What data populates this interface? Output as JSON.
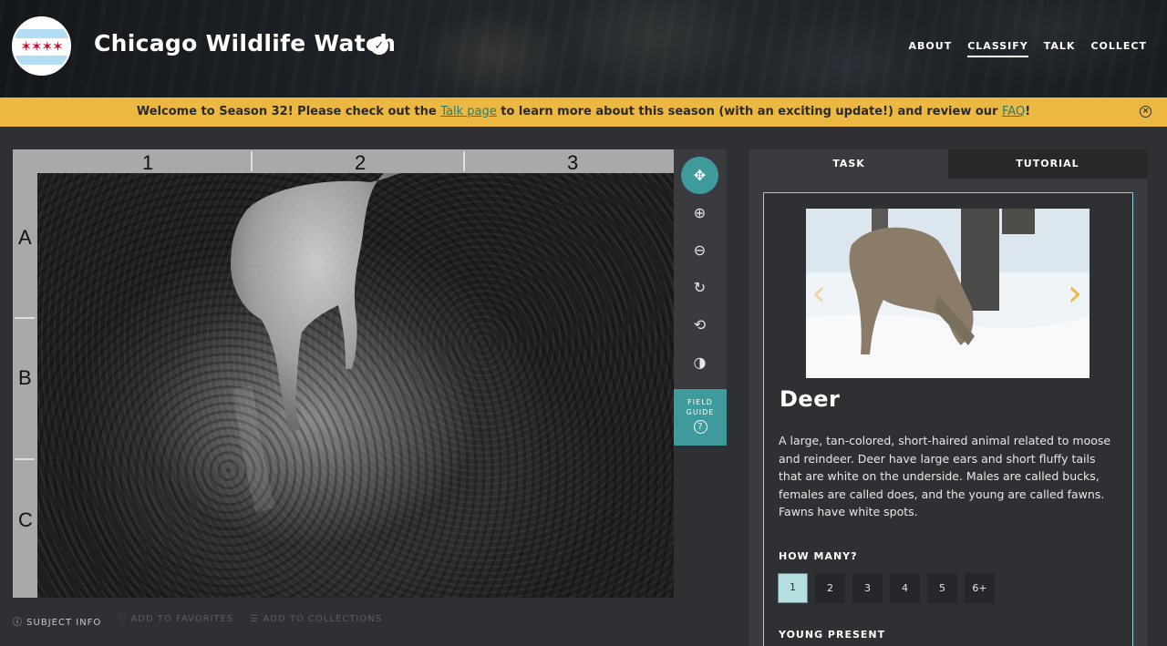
{
  "header": {
    "title": "Chicago Wildlife Watch",
    "logo_stars": "✶✶✶✶",
    "verified_icon": "✓",
    "nav": [
      {
        "label": "ABOUT",
        "active": false
      },
      {
        "label": "CLASSIFY",
        "active": true
      },
      {
        "label": "TALK",
        "active": false
      },
      {
        "label": "COLLECT",
        "active": false
      }
    ]
  },
  "banner": {
    "text_before": "Welcome to Season 32! Please check out the ",
    "link1": "Talk page",
    "text_middle": " to learn more about this season (with an exciting update!) and review our ",
    "link2": "FAQ",
    "text_after": "!",
    "close_icon": "×"
  },
  "viewer": {
    "columns": [
      "1",
      "2",
      "3"
    ],
    "rows": [
      "A",
      "B",
      "C"
    ],
    "tools": [
      {
        "name": "move-icon",
        "glyph": "✥",
        "active": true
      },
      {
        "name": "zoom-in-icon",
        "glyph": "⊕",
        "active": false
      },
      {
        "name": "zoom-out-icon",
        "glyph": "⊖",
        "active": false
      },
      {
        "name": "rotate-icon",
        "glyph": "↻",
        "active": false
      },
      {
        "name": "reset-icon",
        "glyph": "⟲",
        "active": false
      },
      {
        "name": "invert-icon",
        "glyph": "◑",
        "active": false
      }
    ],
    "field_guide_line1": "FIELD",
    "field_guide_line2": "GUIDE",
    "field_guide_icon": "?"
  },
  "meta_bar": {
    "subject_info": "ⓘ SUBJECT INFO",
    "add_favorites": "♡ ADD TO FAVORITES",
    "add_collections": "☰ ADD TO COLLECTIONS"
  },
  "task_panel": {
    "tabs": [
      {
        "label": "TASK",
        "active": true
      },
      {
        "label": "TUTORIAL",
        "active": false
      }
    ],
    "species": {
      "name": "Deer",
      "description": "A large, tan-colored, short-haired animal related to moose and reindeer. Deer have large ears and short fluffy tails that are white on the underside. Males are called bucks, females are called does, and the young are called fawns. Fawns have white spots.",
      "prev_arrow": "‹",
      "next_arrow": "›"
    },
    "how_many": {
      "title": "HOW MANY?",
      "options": [
        "1",
        "2",
        "3",
        "4",
        "5",
        "6+"
      ],
      "selected": "1"
    },
    "young_present": {
      "title": "YOUNG PRESENT"
    }
  },
  "colors": {
    "accent_teal": "#3f9a9c",
    "banner_yellow": "#ecb842",
    "background": "#2f3033"
  }
}
